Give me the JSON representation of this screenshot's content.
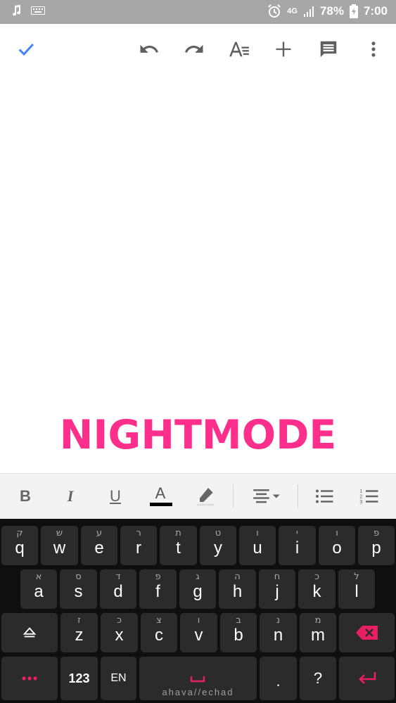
{
  "status_bar": {
    "icons_left": [
      "music-note-icon",
      "keyboard-icon"
    ],
    "network": "4G",
    "battery": "78%",
    "time": "7:00"
  },
  "toolbar": {
    "icons": [
      "check-icon",
      "undo-icon",
      "redo-icon",
      "text-format-icon",
      "add-icon",
      "comment-icon",
      "more-vert-icon"
    ],
    "accent": "#4285f4"
  },
  "document": {
    "overlay_text": "NIGHTMODE",
    "overlay_color": "#fe2e8c"
  },
  "format_bar": {
    "bold": "B",
    "italic": "I",
    "underline": "U",
    "text_color": "A"
  },
  "keyboard": {
    "row1": [
      {
        "key": "q",
        "hint": "ק"
      },
      {
        "key": "w",
        "hint": "ש"
      },
      {
        "key": "e",
        "hint": "ע"
      },
      {
        "key": "r",
        "hint": "ר"
      },
      {
        "key": "t",
        "hint": "ת"
      },
      {
        "key": "y",
        "hint": "ט"
      },
      {
        "key": "u",
        "hint": "ו"
      },
      {
        "key": "i",
        "hint": "י"
      },
      {
        "key": "o",
        "hint": "ו"
      },
      {
        "key": "p",
        "hint": "פ"
      }
    ],
    "row2": [
      {
        "key": "a",
        "hint": "א"
      },
      {
        "key": "s",
        "hint": "ס"
      },
      {
        "key": "d",
        "hint": "ד"
      },
      {
        "key": "f",
        "hint": "פ"
      },
      {
        "key": "g",
        "hint": "ג"
      },
      {
        "key": "h",
        "hint": "ה"
      },
      {
        "key": "j",
        "hint": "ח"
      },
      {
        "key": "k",
        "hint": "כ"
      },
      {
        "key": "l",
        "hint": "ל"
      }
    ],
    "row3": [
      {
        "key": "z",
        "hint": "ז"
      },
      {
        "key": "x",
        "hint": "כ"
      },
      {
        "key": "c",
        "hint": "צ"
      },
      {
        "key": "v",
        "hint": "ו"
      },
      {
        "key": "b",
        "hint": "ב"
      },
      {
        "key": "n",
        "hint": "נ"
      },
      {
        "key": "m",
        "hint": "מ"
      }
    ],
    "numbers_label": "123",
    "language_label": "EN",
    "space_label": "ahava//echad",
    "period": ".",
    "question": "?",
    "accent_color": "#e91e63"
  }
}
